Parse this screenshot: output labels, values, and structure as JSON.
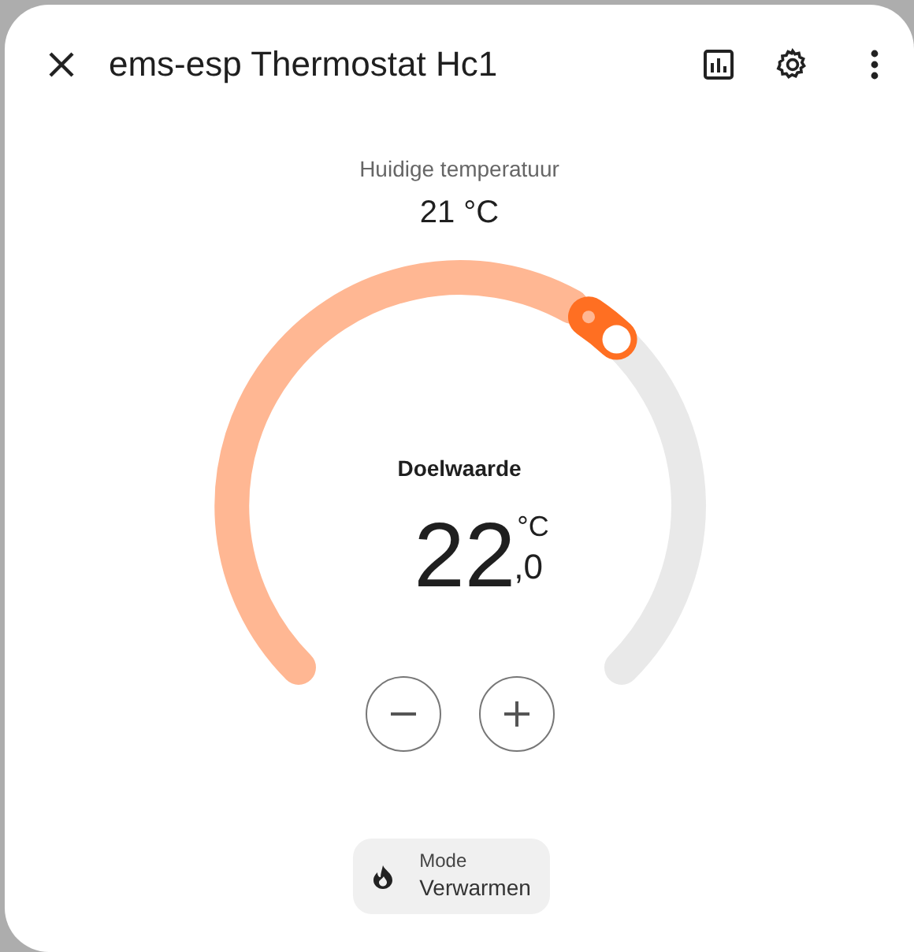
{
  "dialog": {
    "title": "ems-esp Thermostat Hc1"
  },
  "current": {
    "label": "Huidige temperatuur",
    "value": "21 °C"
  },
  "target": {
    "label": "Doelwaarde",
    "value": "22",
    "unit": "°C",
    "decimal": ",0"
  },
  "mode": {
    "label": "Mode",
    "value": "Verwarmen"
  }
}
